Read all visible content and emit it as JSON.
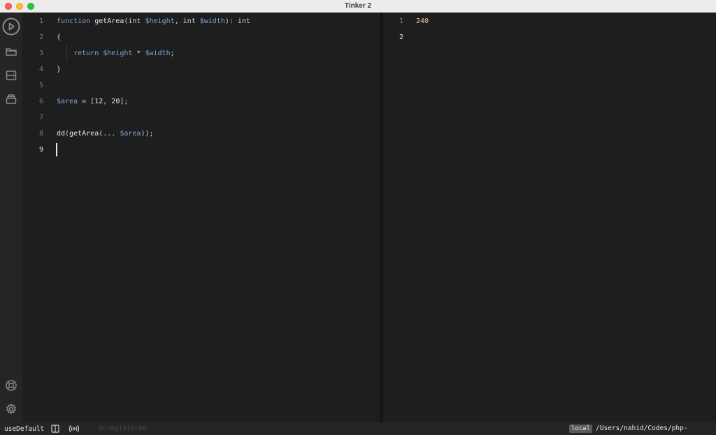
{
  "window": {
    "title": "Tinker 2"
  },
  "sidebar": {
    "items": [
      {
        "name": "run-icon"
      },
      {
        "name": "folder-icon"
      },
      {
        "name": "server-icon"
      },
      {
        "name": "stack-icon"
      },
      {
        "name": "help-icon"
      },
      {
        "name": "settings-icon"
      }
    ]
  },
  "editor": {
    "active_line": 9,
    "lines": [
      {
        "num": "1",
        "tokens": [
          [
            "kw",
            "function"
          ],
          [
            "t",
            " "
          ],
          [
            "fn",
            "getArea"
          ],
          [
            "t",
            "(int "
          ],
          [
            "var",
            "$height"
          ],
          [
            "t",
            ", int "
          ],
          [
            "var",
            "$width"
          ],
          [
            "t",
            "): int"
          ]
        ]
      },
      {
        "num": "2",
        "tokens": [
          [
            "t",
            "{"
          ]
        ]
      },
      {
        "num": "3",
        "tokens": [
          [
            "t",
            "    "
          ],
          [
            "kw",
            "return"
          ],
          [
            "t",
            " "
          ],
          [
            "var",
            "$height"
          ],
          [
            "t",
            " * "
          ],
          [
            "var",
            "$width"
          ],
          [
            "t",
            ";"
          ]
        ]
      },
      {
        "num": "4",
        "tokens": [
          [
            "t",
            "}"
          ]
        ]
      },
      {
        "num": "5",
        "tokens": []
      },
      {
        "num": "6",
        "tokens": [
          [
            "var",
            "$area"
          ],
          [
            "t",
            " = ["
          ],
          [
            "num",
            "12"
          ],
          [
            "t",
            ", "
          ],
          [
            "num",
            "20"
          ],
          [
            "t",
            "];"
          ]
        ]
      },
      {
        "num": "7",
        "tokens": []
      },
      {
        "num": "8",
        "tokens": [
          [
            "fn",
            "dd"
          ],
          [
            "t",
            "("
          ],
          [
            "fn",
            "getArea"
          ],
          [
            "t",
            "(... "
          ],
          [
            "var",
            "$area"
          ],
          [
            "t",
            "));"
          ]
        ]
      },
      {
        "num": "9",
        "tokens": []
      }
    ]
  },
  "output": {
    "active_line": 2,
    "lines": [
      {
        "num": "1",
        "value": "240"
      },
      {
        "num": "2",
        "value": ""
      }
    ]
  },
  "statusbar": {
    "config": "useDefault",
    "registration": "Unregistered",
    "env_badge": "local",
    "path": "/Users/nahid/Codes/php-practice"
  },
  "colors": {
    "keyword": "#7fa7d8",
    "variable": "#7fa7d8",
    "output_value": "#e8c98a",
    "background": "#1e1e1e"
  }
}
